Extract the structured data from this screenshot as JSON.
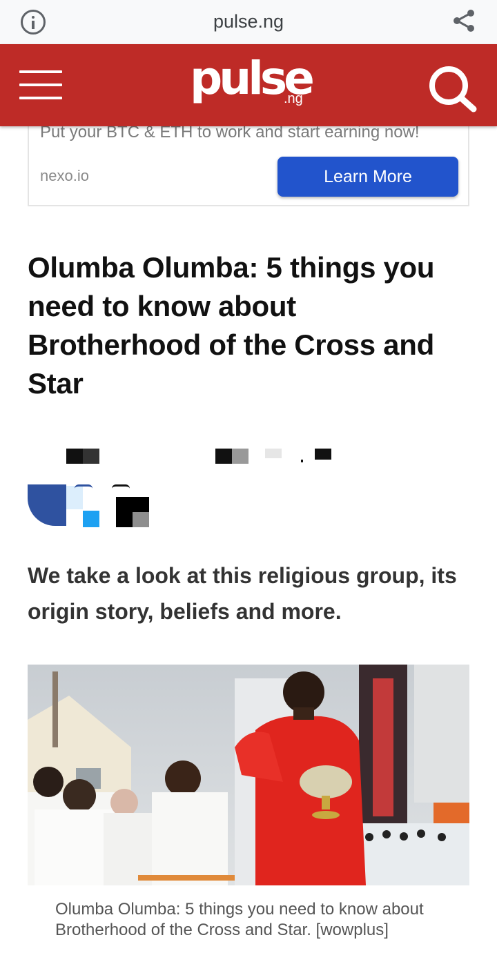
{
  "browser": {
    "url": "pulse.ng",
    "info_icon": "info-icon",
    "share_icon": "share-icon"
  },
  "header": {
    "logo_word": "pulse",
    "logo_tld": ".ng",
    "menu_icon": "hamburger-menu-icon",
    "search_icon": "search-icon",
    "background_color": "#be2b27"
  },
  "ad": {
    "tagline": "Put your BTC & ETH to work and start earning now!",
    "domain": "nexo.io",
    "cta_label": "Learn More",
    "cta_color": "#2254cc"
  },
  "article": {
    "headline": "Olumba Olumba: 5 things you need to know about Brotherhood of the Cross and Star",
    "subheadline": "We take a look at this religious group, its origin story, beliefs and more.",
    "photo_caption": "Olumba Olumba: 5 things you need to know about Brotherhood of the Cross and Star. [wowplus]"
  }
}
